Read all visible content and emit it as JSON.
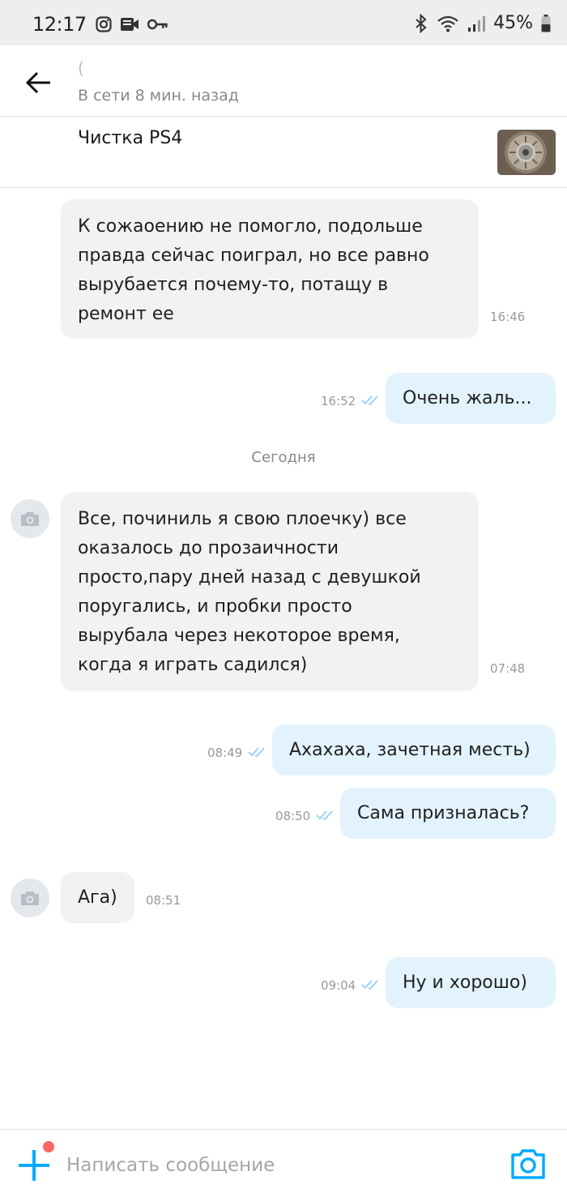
{
  "status_bar": {
    "time": "12:17",
    "battery": "45%"
  },
  "header": {
    "name": "(",
    "status": "В сети 8 мин. назад"
  },
  "listing": {
    "title": "Чистка PS4"
  },
  "messages": [
    {
      "direction": "incoming",
      "lines": [
        "К сожаоению не помогло, подольше",
        "правда сейчас поиграл, но все равно",
        "вырубается почему-то, потащу в",
        "ремонт ее"
      ],
      "time": "16:46"
    },
    {
      "direction": "outgoing",
      "text": "Очень жаль...",
      "time": "16:52"
    },
    {
      "direction": "incoming",
      "lines": [
        "Все, починиль я свою плоечку) все",
        "оказалось до прозаичности",
        "просто,пару дней назад с девушкой",
        "поругались, и пробки просто",
        "вырубала через некоторое время,",
        "когда я играть садился)"
      ],
      "time": "07:48"
    },
    {
      "direction": "outgoing",
      "text": "Ахахаха, зачетная месть)",
      "time": "08:49"
    },
    {
      "direction": "outgoing",
      "text": "Сама призналась?",
      "time": "08:50"
    },
    {
      "direction": "incoming",
      "text": "Ага)",
      "time": "08:51"
    },
    {
      "direction": "outgoing",
      "text": "Ну и хорошо)",
      "time": "09:04"
    }
  ],
  "date_separator": "Сегодня",
  "composer": {
    "placeholder": "Написать сообщение"
  },
  "colors": {
    "accent": "#00aaff",
    "incoming_bubble": "#f2f2f2",
    "outgoing_bubble": "#e3f3fd",
    "read_checks": "#8fd0f5",
    "notification_dot": "#ff6666"
  },
  "icons": [
    "instagram-icon",
    "message-icon",
    "key-icon",
    "bluetooth-icon",
    "wifi-icon",
    "signal-icon",
    "battery-icon",
    "back-arrow-icon",
    "camera-icon",
    "plus-icon"
  ]
}
